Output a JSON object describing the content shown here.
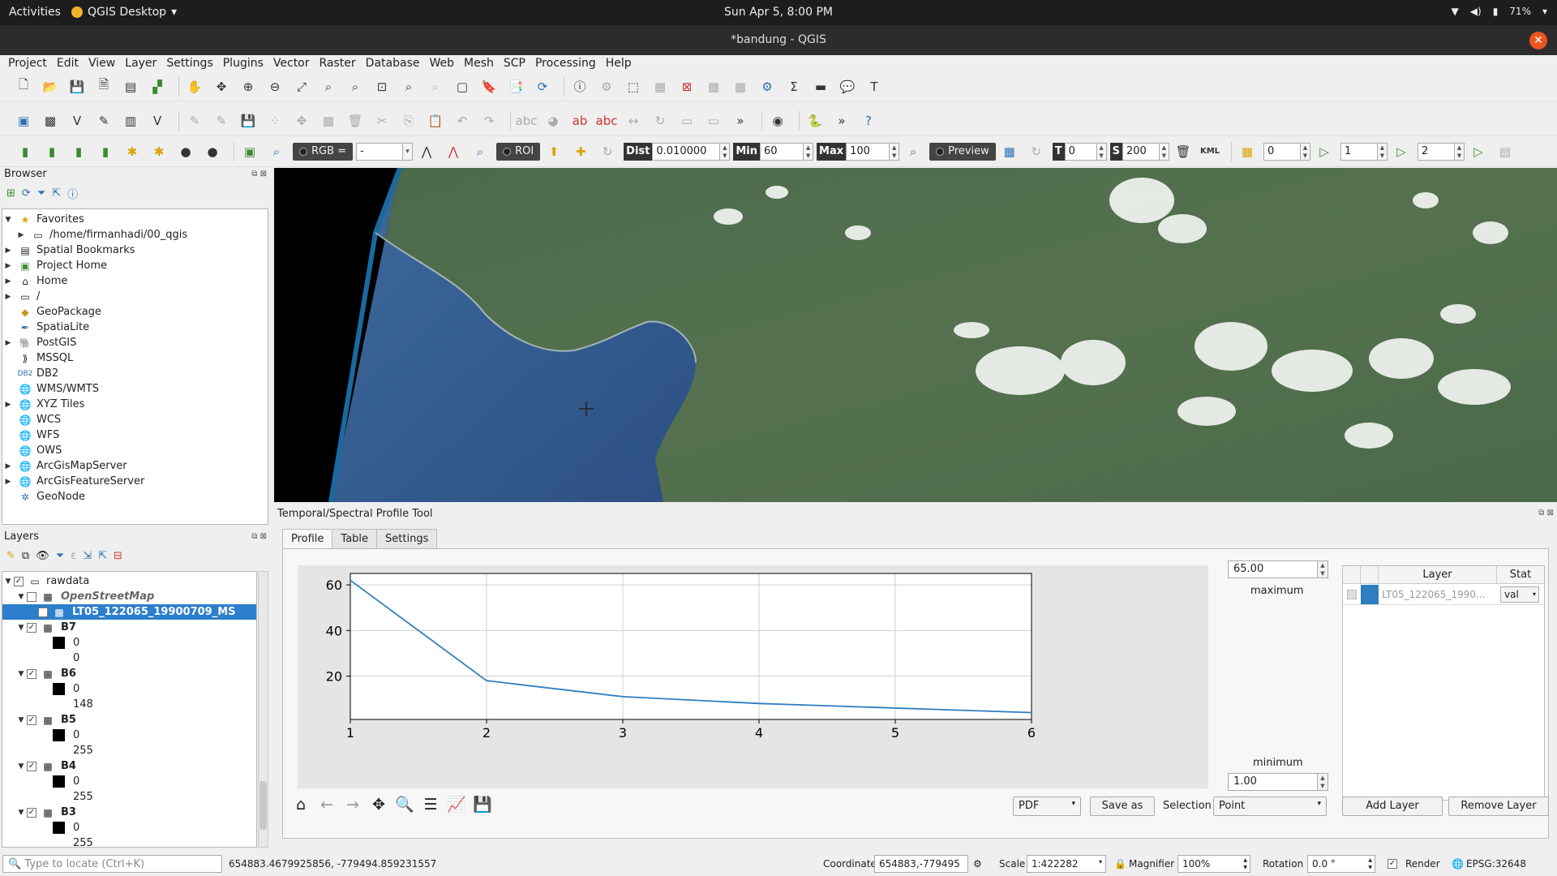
{
  "topbar": {
    "activities": "Activities",
    "app_menu": "QGIS Desktop",
    "clock": "Sun Apr  5,  8:00 PM",
    "battery": "71%"
  },
  "window": {
    "title": "*bandung - QGIS"
  },
  "menu": [
    "Project",
    "Edit",
    "View",
    "Layer",
    "Settings",
    "Plugins",
    "Vector",
    "Raster",
    "Database",
    "Web",
    "Mesh",
    "SCP",
    "Processing",
    "Help"
  ],
  "scp_toolbar": {
    "rgb_label": "RGB =",
    "rgb_value": "-",
    "roi_label": "ROI",
    "dist_label": "Dist",
    "dist_value": "0.010000",
    "min_label": "Min",
    "min_value": "60",
    "max_label": "Max",
    "max_value": "100",
    "preview_label": "Preview",
    "t_label": "T",
    "t_value": "0",
    "s_label": "S",
    "s_value": "200",
    "kml_label": "KML",
    "band_a": "0",
    "band_b": "1",
    "band_c": "2"
  },
  "browser": {
    "title": "Browser",
    "items": [
      {
        "label": "Favorites",
        "icon": "star-icon",
        "expanded": true
      },
      {
        "label": "/home/firmanhadi/00_qgis",
        "icon": "folder-icon",
        "indent": 1
      },
      {
        "label": "Spatial Bookmarks",
        "icon": "bookmark-icon"
      },
      {
        "label": "Project Home",
        "icon": "project-home-icon"
      },
      {
        "label": "Home",
        "icon": "home-icon"
      },
      {
        "label": "/",
        "icon": "folder-icon"
      },
      {
        "label": "GeoPackage",
        "icon": "geopackage-icon"
      },
      {
        "label": "SpatiaLite",
        "icon": "spatialite-icon"
      },
      {
        "label": "PostGIS",
        "icon": "postgis-icon"
      },
      {
        "label": "MSSQL",
        "icon": "mssql-icon"
      },
      {
        "label": "DB2",
        "icon": "db2-icon"
      },
      {
        "label": "WMS/WMTS",
        "icon": "globe-icon"
      },
      {
        "label": "XYZ Tiles",
        "icon": "globe-icon"
      },
      {
        "label": "WCS",
        "icon": "globe-icon"
      },
      {
        "label": "WFS",
        "icon": "globe-icon"
      },
      {
        "label": "OWS",
        "icon": "globe-icon"
      },
      {
        "label": "ArcGisMapServer",
        "icon": "globe-icon"
      },
      {
        "label": "ArcGisFeatureServer",
        "icon": "globe-icon"
      },
      {
        "label": "GeoNode",
        "icon": "geonode-icon"
      }
    ]
  },
  "layers": {
    "title": "Layers",
    "group": "rawdata",
    "osm": "OpenStreetMap",
    "selected": "LT05_122065_19900709_MS",
    "bands": [
      {
        "name": "B7",
        "min": "0",
        "max": "0"
      },
      {
        "name": "B6",
        "min": "0",
        "max": "148"
      },
      {
        "name": "B5",
        "min": "0",
        "max": "255"
      },
      {
        "name": "B4",
        "min": "0",
        "max": "255"
      },
      {
        "name": "B3",
        "min": "0",
        "max": "255"
      }
    ]
  },
  "profile": {
    "title": "Temporal/Spectral Profile Tool",
    "tabs": [
      "Profile",
      "Table",
      "Settings"
    ],
    "max_value": "65.00",
    "max_label": "maximum",
    "min_label": "minimum",
    "min_value": "1.00",
    "table_header_layer": "Layer",
    "table_header_stat": "Stat",
    "table_layer": "LT05_122065_1990...",
    "table_stat": "val",
    "table_color": "#2f7ec2",
    "export_format": "PDF",
    "save_as": "Save as",
    "selection_label": "Selection",
    "selection_value": "Point",
    "add_layer": "Add Layer",
    "remove_layer": "Remove Layer"
  },
  "chart_data": {
    "type": "line",
    "x": [
      1,
      2,
      3,
      4,
      5,
      6
    ],
    "series": [
      {
        "values": [
          62,
          18,
          11,
          8,
          6,
          4
        ],
        "color": "#2f7ec2"
      }
    ],
    "xlim": [
      1,
      6
    ],
    "ylim": [
      1,
      65
    ],
    "xticks": [
      "1",
      "2",
      "3",
      "4",
      "5",
      "6"
    ],
    "yticks": [
      "20",
      "40",
      "60"
    ],
    "grid": true
  },
  "statusbar": {
    "locator_placeholder": "Type to locate (Ctrl+K)",
    "cursor_coord": "654883.4679925856, -779494.859231557",
    "coordinate_label": "Coordinate",
    "coordinate_value": "654883,-779495",
    "scale_label": "Scale",
    "scale_value": "1:422282",
    "magnifier_label": "Magnifier",
    "magnifier_value": "100%",
    "rotation_label": "Rotation",
    "rotation_value": "0.0 °",
    "render_label": "Render",
    "crs": "EPSG:32648"
  }
}
